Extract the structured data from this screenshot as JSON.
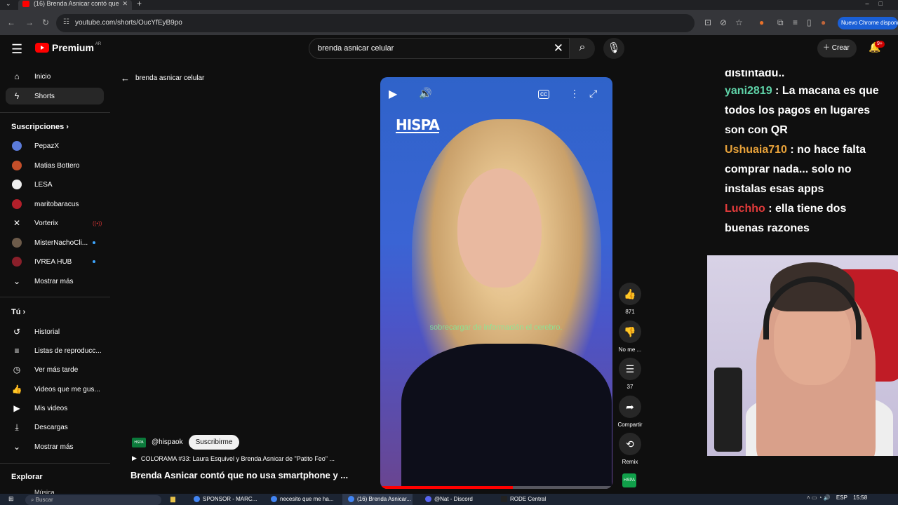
{
  "browser": {
    "tab_title": "(16) Brenda Asnicar contó que",
    "url": "youtube.com/shorts/OucYfEyB9po",
    "chrome_button": "Nuevo Chrome disponible"
  },
  "header": {
    "logo_text": "Premium",
    "logo_sup": "AR",
    "search_value": "brenda asnicar celular",
    "create_label": "Crear",
    "notif_count": "9+"
  },
  "sidebar": {
    "home": "Inicio",
    "shorts": "Shorts",
    "subs_header": "Suscripciones",
    "subs": [
      {
        "name": "PepazX",
        "color": "#5b7bd9"
      },
      {
        "name": "Matias Bottero",
        "color": "#c44f2a"
      },
      {
        "name": "LESA",
        "color": "#eeeeee"
      },
      {
        "name": "maritobaracus",
        "color": "#b21f2a"
      },
      {
        "name": "Vorterix",
        "color": "#111111"
      },
      {
        "name": "MisterNachoCli...",
        "color": "#6d5b4a"
      },
      {
        "name": "IVREA HUB",
        "color": "#8a1f2a"
      }
    ],
    "show_more": "Mostrar más",
    "you_header": "Tú",
    "you_items": [
      "Historial",
      "Listas de reproducc...",
      "Ver más tarde",
      "Videos que me gus...",
      "Mis videos",
      "Descargas"
    ],
    "show_more2": "Mostrar más",
    "explore_header": "Explorar",
    "explore_item": "Música"
  },
  "main": {
    "back_label": "brenda asnicar celular",
    "video_logo": "HISPA",
    "video_subtitle": "sobrecargar de información el cerebro.",
    "actions": {
      "like_count": "871",
      "dislike_label": "No me ...",
      "comments_count": "37",
      "share_label": "Compartir",
      "remix_label": "Remix"
    },
    "channel": "@hispaok",
    "subscribe": "Suscribirme",
    "playlist": "COLORAMA #33: Laura Esquivel y Brenda Asnicar de \"Patito Feo\" ...",
    "title": "Brenda Asnicar contó que no usa smartphone y ...",
    "progress": 0.57
  },
  "chat": {
    "lines": [
      {
        "user": "",
        "text": "distintadu.."
      },
      {
        "user": "yani2819",
        "user_color": "#5fd3a8",
        "text": " : La macana es que"
      },
      {
        "user": "",
        "text": "todos los pagos en lugares"
      },
      {
        "user": "",
        "text": "son con QR"
      },
      {
        "user": "Ushuaia710",
        "user_color": "#e8a23a",
        "text": " : no hace falta"
      },
      {
        "user": "",
        "text": "comprar nada... solo no"
      },
      {
        "user": "",
        "text": "instalas esas apps"
      },
      {
        "user": "Luchho",
        "user_color": "#e23b3b",
        "text": " : ella tiene dos"
      },
      {
        "user": "",
        "text": "buenas razones"
      }
    ]
  },
  "taskbar": {
    "search": "Buscar",
    "items": [
      "SPONSOR - MARC...",
      "necesito que me ha...",
      "(16) Brenda Asnicar...",
      "@Nat - Discord",
      "RODE Central"
    ],
    "lang": "ESP",
    "time": "15:58"
  }
}
